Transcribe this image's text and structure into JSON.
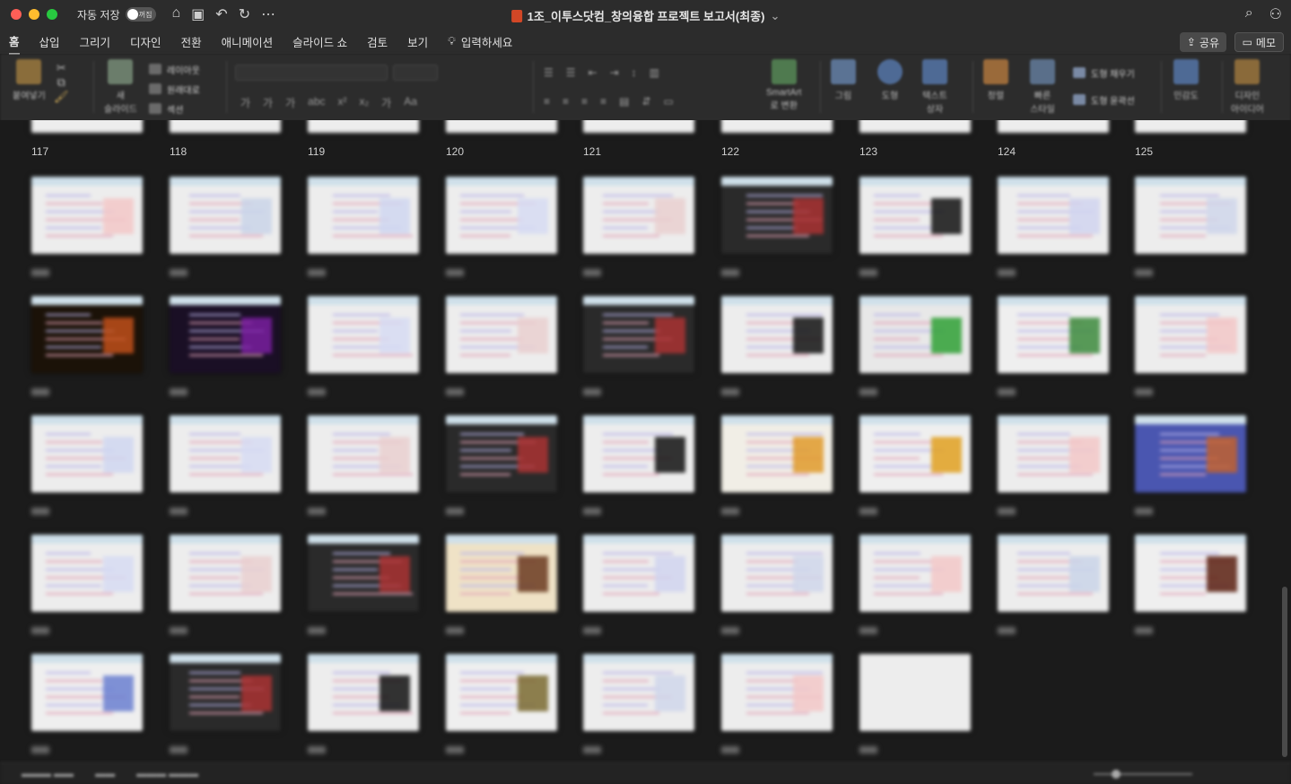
{
  "window": {
    "autosave_label": "자동 저장",
    "autosave_toggle": "꺼짐",
    "doc_title": "1조_이투스닷컴_창의융합 프로젝트 보고서(최종)",
    "title_chevron": "⌄",
    "traffic_colors": [
      "#ff5f57",
      "#febc2e",
      "#28c840"
    ]
  },
  "ribbon_tabs": {
    "items": [
      "홈",
      "삽입",
      "그리기",
      "디자인",
      "전환",
      "애니메이션",
      "슬라이드 쇼",
      "검토",
      "보기"
    ],
    "active_index": 0,
    "tell_me": "입력하세요",
    "share": "공유",
    "memo": "메모"
  },
  "ribbon": {
    "paste": "붙여넣기",
    "new_slide": "새\n슬라이드",
    "layout": "레이아웃",
    "reset": "원래대로",
    "section": "섹션",
    "smartart": "SmartArt\n로 변환",
    "picture": "그림",
    "shapes": "도형",
    "textbox": "텍스트\n상자",
    "arrange": "정렬",
    "quick_styles": "빠른\n스타일",
    "shape_fill": "도형 채우기",
    "shape_outline": "도형 윤곽선",
    "sensitivity": "민감도",
    "designer": "디자인\n아이디어"
  },
  "sorter": {
    "top_row_numbers": [
      "117",
      "118",
      "119",
      "120",
      "121",
      "122",
      "123",
      "124",
      "125"
    ]
  },
  "icons": [
    "home-icon",
    "save-icon",
    "undo-icon",
    "redo-icon",
    "more-icon",
    "search-icon",
    "account-icon",
    "lightbulb-icon",
    "share-icon",
    "comment-icon"
  ]
}
